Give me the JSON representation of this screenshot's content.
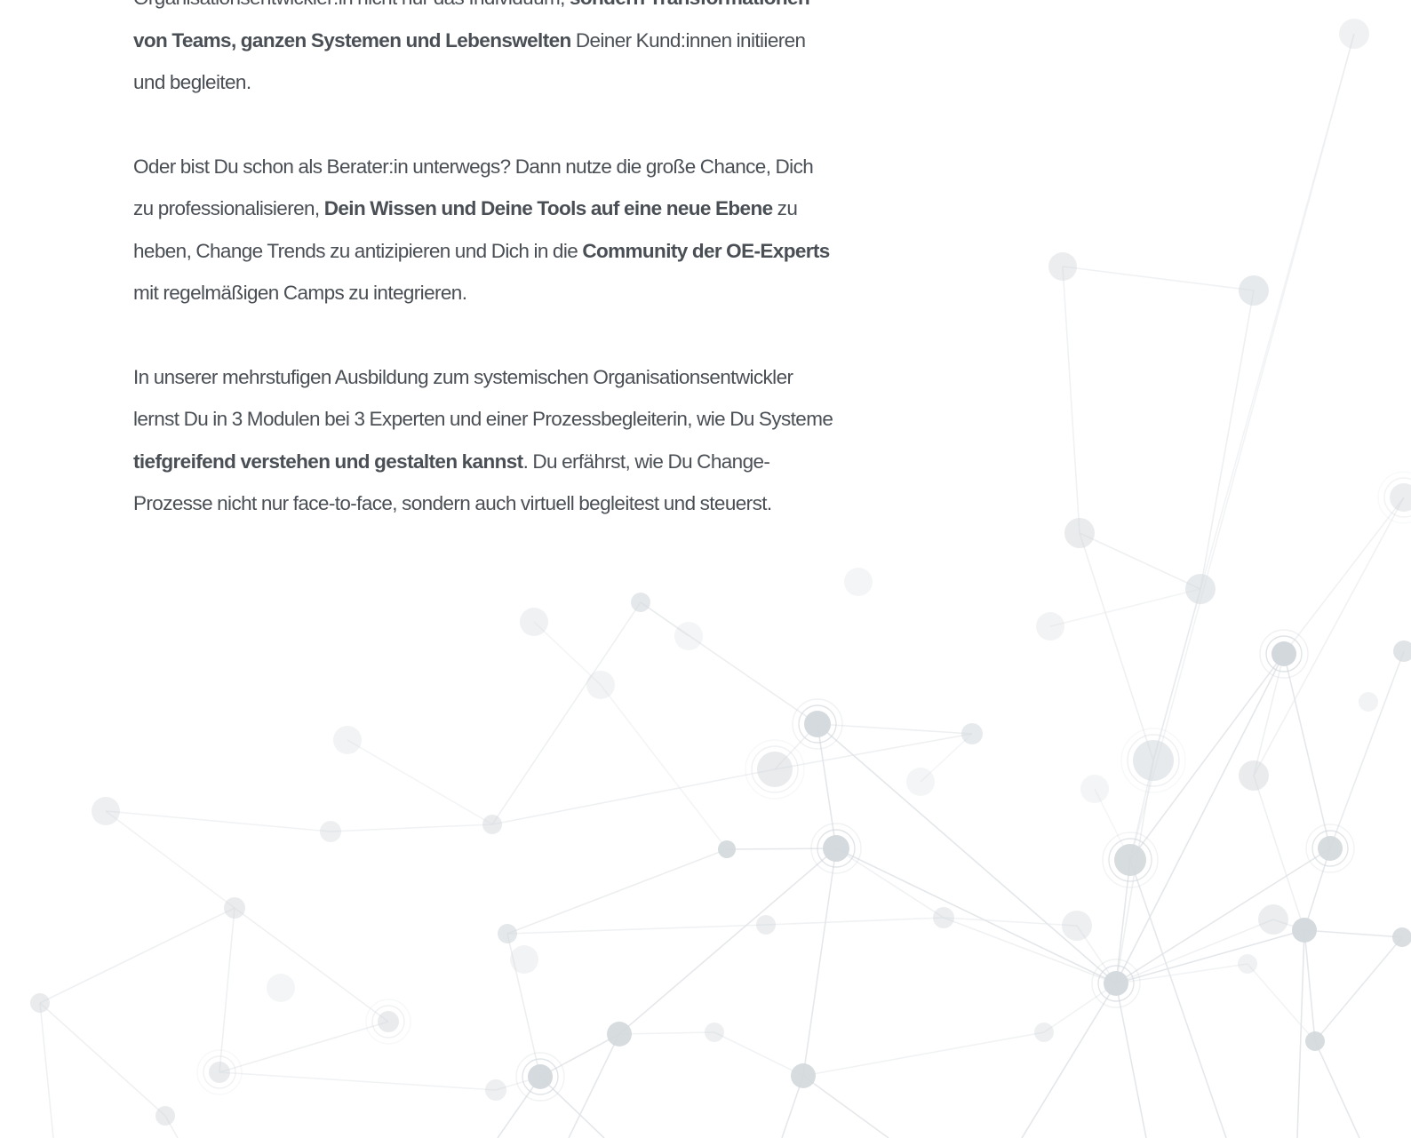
{
  "article": {
    "paragraph1": {
      "s1": "Organisationsentwickler:in nicht nur das Individuum,",
      "b1": "sondern Transformationen von Teams, ganzen Systemen und Lebenswelten",
      "s2": "Deiner Kund:innen initiieren und begleiten."
    },
    "paragraph2": {
      "s1": "Oder bist Du schon als Berater:in unterwegs? Dann nutze die große Chance, Dich zu professionalisieren,",
      "b1": "Dein Wissen und Deine Tools auf eine neue Ebene",
      "s2": "zu heben, Change Trends zu antizipieren und Dich in die",
      "b2": "Community der OE-Experts",
      "s3": "mit regelmäßigen Camps zu integrieren."
    },
    "paragraph3": {
      "s1": "In unserer mehrstufigen Ausbildung zum systemischen Organisationsentwickler lernst Du in 3 Modulen bei 3 Experten und einer Prozessbegleiterin, wie Du Systeme",
      "b1": "tiefgreifend verstehen und gestalten kannst",
      "s2": ". Du erfährst, wie Du Change-Prozesse nicht nur face-to-face, sondern auch virtuell begleitest und steuerst."
    }
  },
  "colors": {
    "text": "#4a4f55",
    "network_node": "#d3d8dc",
    "network_line": "#e4e7ea",
    "background": "#ffffff"
  },
  "background": {
    "decoration": "network-graph"
  }
}
